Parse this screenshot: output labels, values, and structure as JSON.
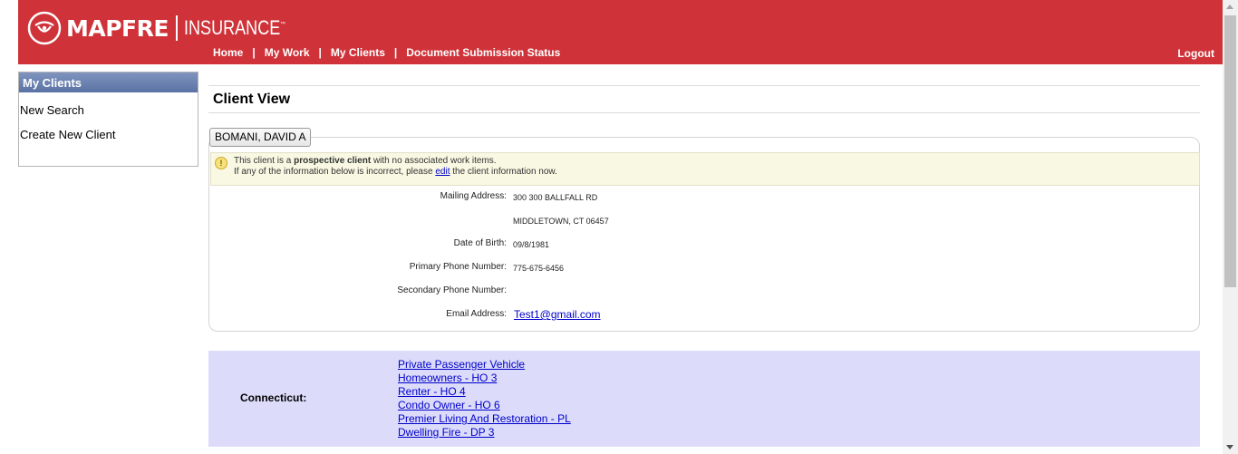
{
  "header": {
    "brand": "MAPFRE",
    "brand_sub": "INSURANCE",
    "trademark": "™",
    "nav": [
      {
        "label": "Home"
      },
      {
        "label": "My Work"
      },
      {
        "label": "My Clients"
      },
      {
        "label": "Document Submission Status"
      }
    ],
    "nav_separator": "|",
    "logout": "Logout"
  },
  "sidebar": {
    "title": "My Clients",
    "links": [
      {
        "label": "New Search"
      },
      {
        "label": "Create New Client"
      }
    ]
  },
  "main": {
    "title": "Client View",
    "client_tab": "BOMANI, DAVID A",
    "notice": {
      "icon": "!",
      "line1_prefix": "This client is a ",
      "line1_bold": "prospective client",
      "line1_suffix": " with no associated work items.",
      "line2_prefix": "If any of the information below is incorrect, please ",
      "line2_link": "edit",
      "line2_suffix": " the client information now."
    },
    "fields": {
      "mailing_label": "Mailing Address:",
      "mailing_line1": "300 300 BALLFALL RD",
      "mailing_line2": "MIDDLETOWN, CT 06457",
      "dob_label": "Date of Birth:",
      "dob_value": "09/8/1981",
      "primary_phone_label": "Primary Phone Number:",
      "primary_phone_value": "775-675-6456",
      "secondary_phone_label": "Secondary Phone Number:",
      "secondary_phone_value": "",
      "email_label": "Email Address:",
      "email_value": "Test1@gmail.com"
    },
    "products": {
      "state": "Connecticut:",
      "links": [
        "Private Passenger Vehicle",
        "Homeowners - HO 3",
        "Renter - HO 4",
        "Condo Owner - HO 6",
        "Premier Living And Restoration - PL",
        "Dwelling Fire - DP 3"
      ]
    }
  }
}
